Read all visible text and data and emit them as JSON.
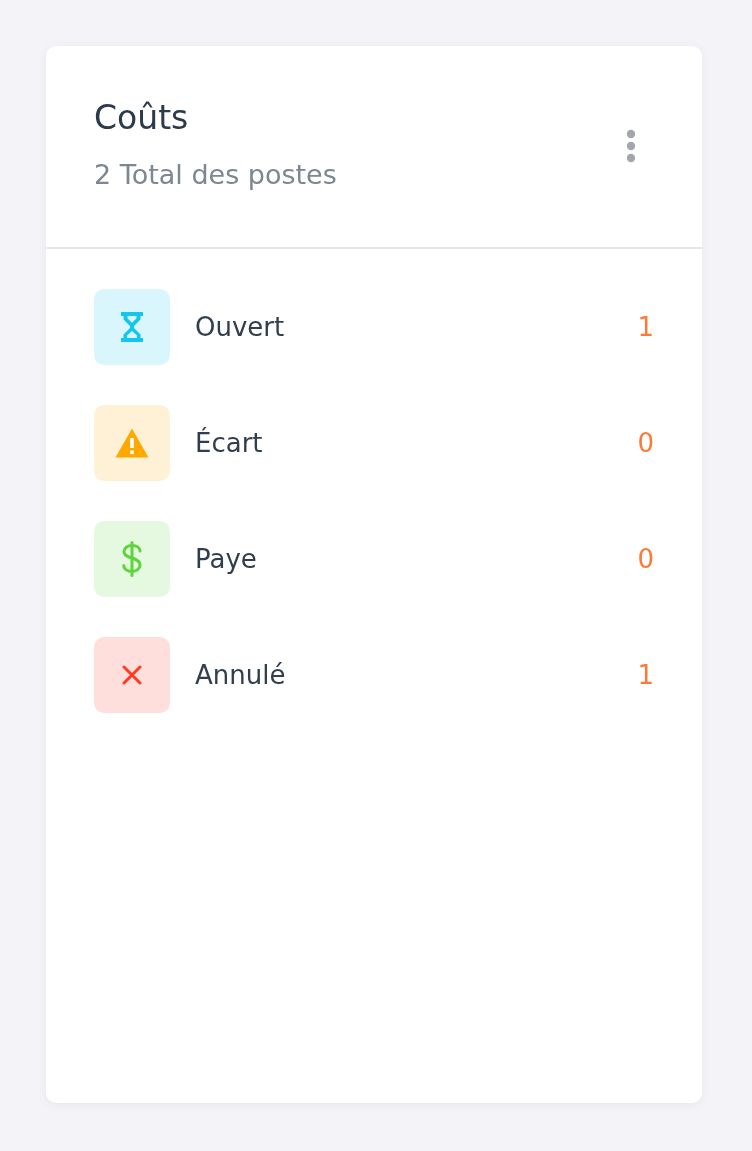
{
  "card": {
    "title": "Coûts",
    "subtitle": "2 Total des postes"
  },
  "statuses": [
    {
      "kind": "pending",
      "label": "Ouvert",
      "count": "1",
      "color": "#13c6ee"
    },
    {
      "kind": "warning",
      "label": "Écart",
      "count": "0",
      "color": "#ffa800"
    },
    {
      "kind": "paid",
      "label": "Paye",
      "count": "0",
      "color": "#5fd43c"
    },
    {
      "kind": "cancelled",
      "label": "Annulé",
      "count": "1",
      "color": "#ff3b21"
    }
  ]
}
